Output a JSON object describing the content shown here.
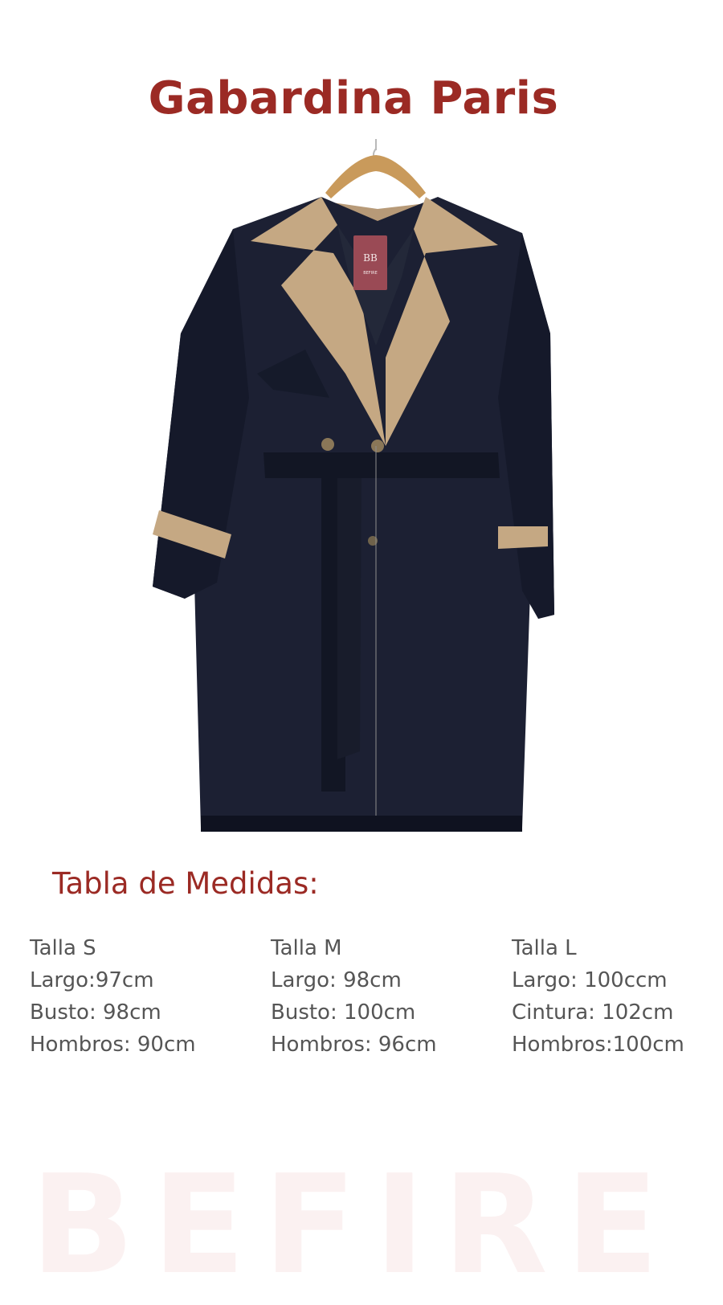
{
  "colors": {
    "accent": "#9b2a24",
    "text": "#555555",
    "watermark": "#fbf1f1",
    "coat": "#1c2033",
    "collar": "#c5a883",
    "tag": "#9a4a55"
  },
  "title": "Gabardina Paris",
  "product_image": {
    "alt_icon": "trench-coat-on-hanger-image",
    "tag_text": "BEFIRE"
  },
  "size_table": {
    "heading": "Tabla de Medidas:",
    "columns": [
      {
        "size": "Talla S",
        "rows": [
          "Largo:97cm",
          "Busto: 98cm",
          "Hombros: 90cm"
        ]
      },
      {
        "size": "Talla M",
        "rows": [
          "Largo: 98cm",
          "Busto: 100cm",
          "Hombros: 96cm"
        ]
      },
      {
        "size": "Talla L",
        "rows": [
          "Largo: 100ccm",
          "Cintura: 102cm",
          "Hombros:100cm"
        ]
      }
    ]
  },
  "watermark": "BEFIRE"
}
